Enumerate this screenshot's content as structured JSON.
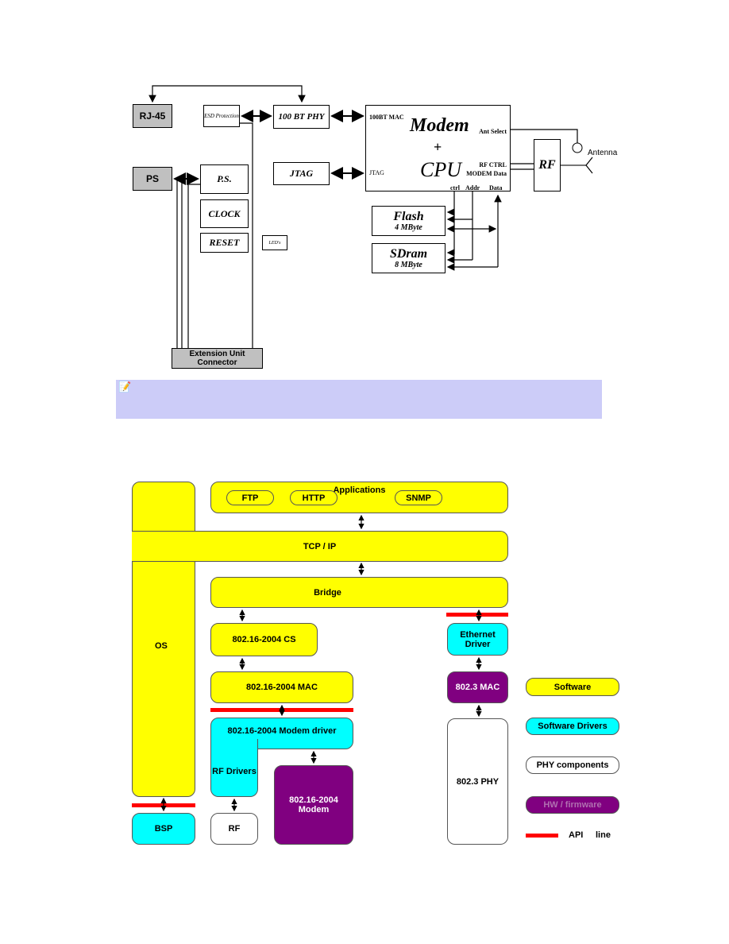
{
  "hardware_diagram": {
    "rj45": "RJ-45",
    "esd": "ESD Protection",
    "phy": "100 BT PHY",
    "modem": "Modem",
    "plus": "+",
    "cpu": "CPU",
    "mac_port": "100BT MAC",
    "jtag_port": "JTAG",
    "ant_select": "Ant Select",
    "rf_ctrl": "RF CTRL",
    "modem_data": "MODEM  Data",
    "ctrl": "ctrl",
    "addr": "Addr",
    "data": "Data",
    "rf": "RF",
    "antenna": "Antenna",
    "ps_gray": "PS",
    "ps": "P.S.",
    "clock": "CLOCK",
    "reset": "RESET",
    "leds": "LED's",
    "jtag": "JTAG",
    "flash": "Flash",
    "flash_size": "4 MByte",
    "sdram": "SDram",
    "sdram_size": "8 MByte",
    "ext": "Extension Unit Connector"
  },
  "note": {
    "icon": "note-pencil-icon",
    "text": ""
  },
  "software_diagram": {
    "applications": "Applications",
    "ftp": "FTP",
    "http": "HTTP",
    "snmp": "SNMP",
    "tcpip": "TCP / IP",
    "bridge": "Bridge",
    "os": "OS",
    "cs": "802.16-2004 CS",
    "mac": "802.16-2004 MAC",
    "modem_driver": "802.16-2004 Modem driver",
    "rf_drivers": "RF Drivers",
    "modem": "802.16-2004 Modem",
    "rf": "RF",
    "bsp": "BSP",
    "eth_driver": "Ethernet Driver",
    "eth_mac": "802.3 MAC",
    "eth_phy": "802.3 PHY",
    "legend": {
      "software": "Software",
      "drivers": "Software Drivers",
      "phy": "PHY components",
      "hw": "HW / firmware",
      "api": "API",
      "line": "line"
    },
    "colors": {
      "software": "#ffff00",
      "drivers": "#00ffff",
      "hw": "#800080",
      "api": "#ff0000"
    }
  }
}
